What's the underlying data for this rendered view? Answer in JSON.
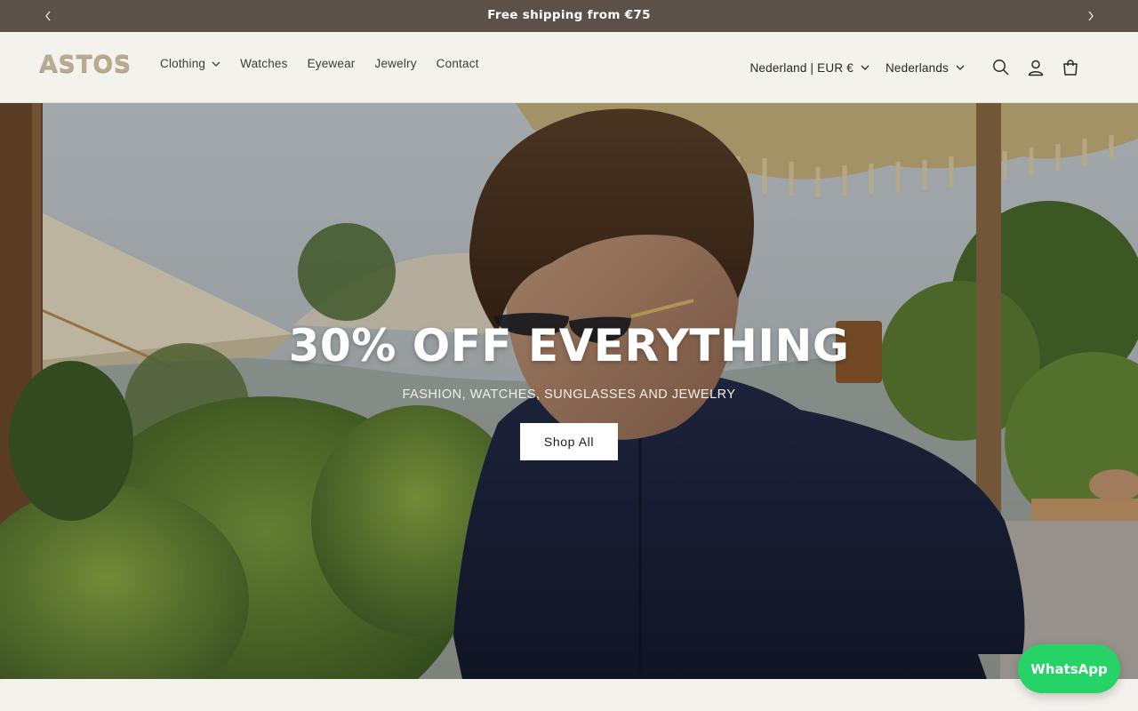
{
  "announcement": {
    "message": "Free shipping from €75",
    "prev_icon": "chevron-left-icon",
    "next_icon": "chevron-right-icon"
  },
  "header": {
    "logo": "ASTOS",
    "nav": [
      {
        "label": "Clothing",
        "has_dropdown": true
      },
      {
        "label": "Watches"
      },
      {
        "label": "Eyewear"
      },
      {
        "label": "Jewelry"
      },
      {
        "label": "Contact"
      }
    ],
    "country_selector": "Nederland | EUR €",
    "language_selector": "Nederlands",
    "icons": [
      "search-icon",
      "account-icon",
      "cart-icon"
    ]
  },
  "hero": {
    "title": "30% OFF EVERYTHING",
    "subtitle": "FASHION, WATCHES, SUNGLASSES AND JEWELRY",
    "button_label": "Shop All"
  },
  "whatsapp": {
    "label": "WhatsApp"
  },
  "colors": {
    "announcement_bg": "#5c5149",
    "header_bg": "#f4f2ed",
    "logo": "#b9ab92",
    "whatsapp": "#25d366"
  }
}
